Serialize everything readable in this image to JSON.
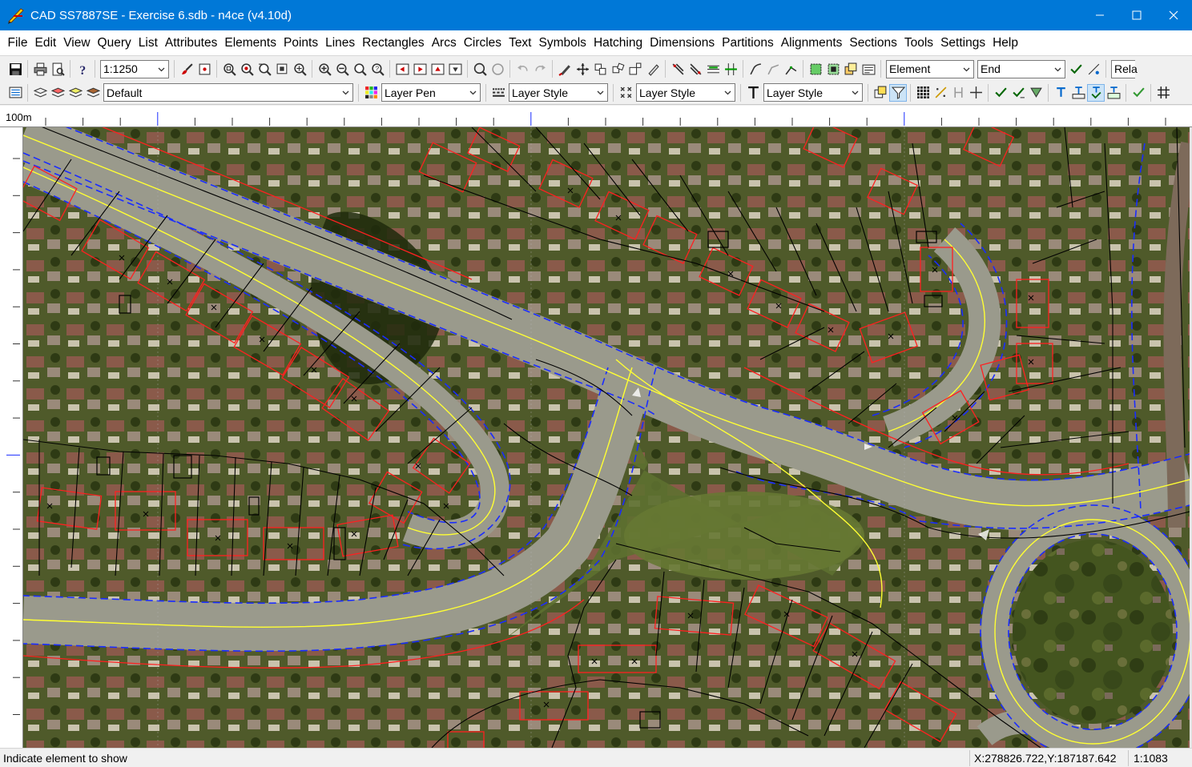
{
  "window": {
    "title": "CAD SS7887SE - Exercise 6.sdb - n4ce (v4.10d)",
    "controls": [
      "minimize",
      "maximize",
      "close"
    ]
  },
  "menu": [
    "File",
    "Edit",
    "View",
    "Query",
    "List",
    "Attributes",
    "Elements",
    "Points",
    "Lines",
    "Rectangles",
    "Arcs",
    "Circles",
    "Text",
    "Symbols",
    "Hatching",
    "Dimensions",
    "Partitions",
    "Alignments",
    "Sections",
    "Tools",
    "Settings",
    "Help"
  ],
  "toolbar1": {
    "scale_value": "1:1250",
    "snap_select": "Element",
    "snap_mode": "End",
    "cut_label": "Rela"
  },
  "toolbar2": {
    "layer": "Default",
    "pen": "Layer Pen",
    "line_style": "Layer Style",
    "point_style": "Layer Style",
    "text_style": "Layer Style"
  },
  "ruler": {
    "unit_label": "100m"
  },
  "status": {
    "prompt": "Indicate element to show",
    "coordinates": "X:278826.722,Y:187187.642",
    "scale": "1:1083"
  },
  "colors": {
    "titlebar": "#0078d7",
    "road_centreline": "#ffff33",
    "kerb_line": "#1a2cff",
    "building_outline": "#ff2020",
    "boundary_line": "#000000"
  }
}
